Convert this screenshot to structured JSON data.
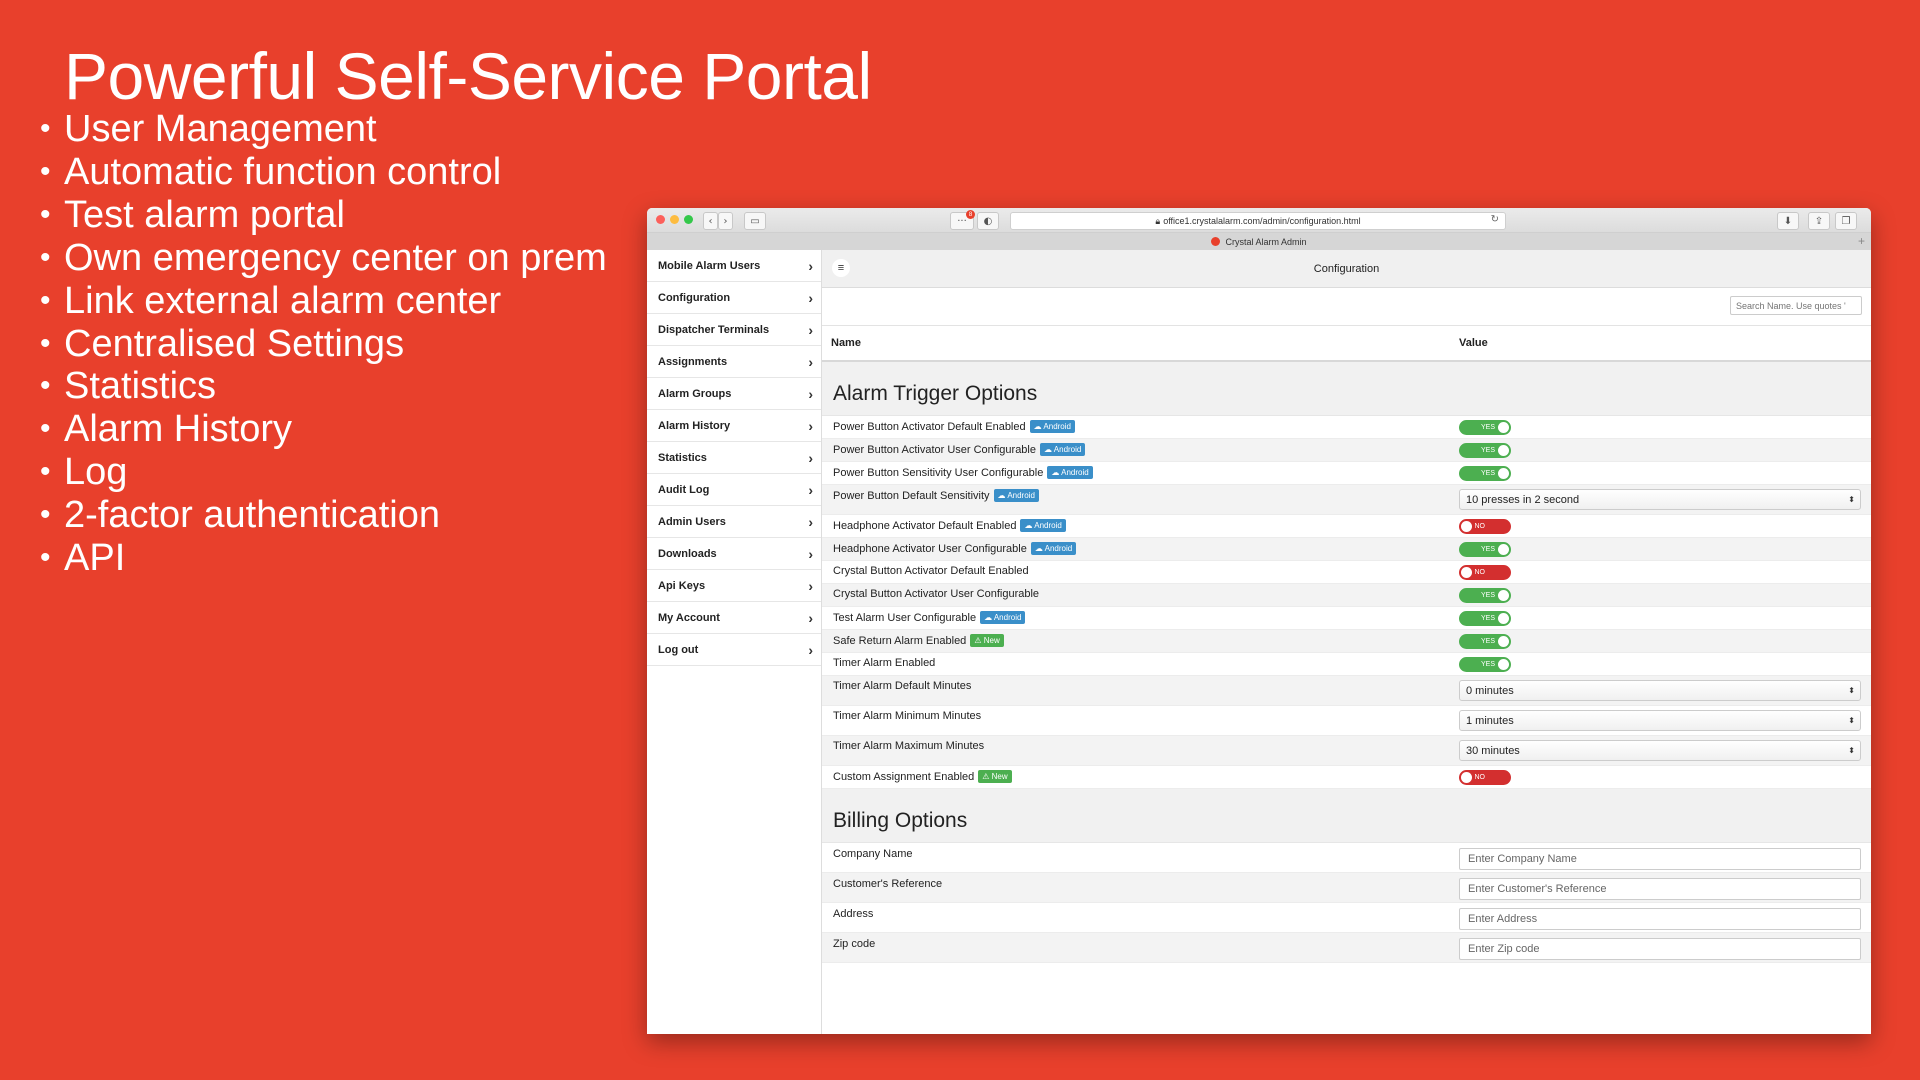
{
  "slide": {
    "title": "Powerful Self-Service Portal",
    "bullets": [
      "User Management",
      "Automatic function control",
      "Test alarm portal",
      "Own emergency center on prem",
      "Link external alarm center",
      "Centralised Settings",
      "Statistics",
      "Alarm History",
      "Log",
      "2-factor authentication",
      "API"
    ]
  },
  "browser": {
    "url": "office1.crystalalarm.com/admin/configuration.html",
    "tab_title": "Crystal Alarm Admin",
    "notification_count": "8"
  },
  "sidebar": {
    "items": [
      "Mobile Alarm Users",
      "Configuration",
      "Dispatcher Terminals",
      "Assignments",
      "Alarm Groups",
      "Alarm History",
      "Statistics",
      "Audit Log",
      "Admin Users",
      "Downloads",
      "Api Keys",
      "My Account",
      "Log out"
    ]
  },
  "main": {
    "header_title": "Configuration",
    "search_placeholder": "Search Name. Use quotes '",
    "col_name": "Name",
    "col_value": "Value"
  },
  "sections": {
    "alarm_trigger": "Alarm Trigger Options",
    "billing": "Billing Options"
  },
  "settings": [
    {
      "label": "Power Button Activator Default Enabled",
      "badge": "Android",
      "type": "toggle",
      "value": "YES"
    },
    {
      "label": "Power Button Activator User Configurable",
      "badge": "Android",
      "type": "toggle",
      "value": "YES"
    },
    {
      "label": "Power Button Sensitivity User Configurable",
      "badge": "Android",
      "type": "toggle",
      "value": "YES"
    },
    {
      "label": "Power Button Default Sensitivity",
      "badge": "Android",
      "type": "select",
      "value": "10 presses in 2 second"
    },
    {
      "label": "Headphone Activator Default Enabled",
      "badge": "Android",
      "type": "toggle",
      "value": "NO"
    },
    {
      "label": "Headphone Activator User Configurable",
      "badge": "Android",
      "type": "toggle",
      "value": "YES"
    },
    {
      "label": "Crystal Button Activator Default Enabled",
      "badge": "",
      "type": "toggle",
      "value": "NO"
    },
    {
      "label": "Crystal Button Activator User Configurable",
      "badge": "",
      "type": "toggle",
      "value": "YES"
    },
    {
      "label": "Test Alarm User Configurable",
      "badge": "Android",
      "type": "toggle",
      "value": "YES"
    },
    {
      "label": "Safe Return Alarm Enabled",
      "badge": "New",
      "type": "toggle",
      "value": "YES"
    },
    {
      "label": "Timer Alarm Enabled",
      "badge": "",
      "type": "toggle",
      "value": "YES"
    },
    {
      "label": "Timer Alarm Default Minutes",
      "badge": "",
      "type": "select",
      "value": "0 minutes"
    },
    {
      "label": "Timer Alarm Minimum Minutes",
      "badge": "",
      "type": "select",
      "value": "1 minutes"
    },
    {
      "label": "Timer Alarm Maximum Minutes",
      "badge": "",
      "type": "select",
      "value": "30 minutes"
    },
    {
      "label": "Custom Assignment Enabled",
      "badge": "New",
      "type": "toggle",
      "value": "NO"
    }
  ],
  "billing_fields": [
    {
      "label": "Company Name",
      "placeholder": "Enter Company Name"
    },
    {
      "label": "Customer's Reference",
      "placeholder": "Enter Customer's Reference"
    },
    {
      "label": "Address",
      "placeholder": "Enter Address"
    },
    {
      "label": "Zip code",
      "placeholder": "Enter Zip code"
    }
  ],
  "colors": {
    "background": "#e8402c",
    "toggle_yes": "#4caf50",
    "toggle_no": "#d32f2f",
    "badge_android": "#3a8fc9",
    "badge_new": "#4caf50"
  }
}
